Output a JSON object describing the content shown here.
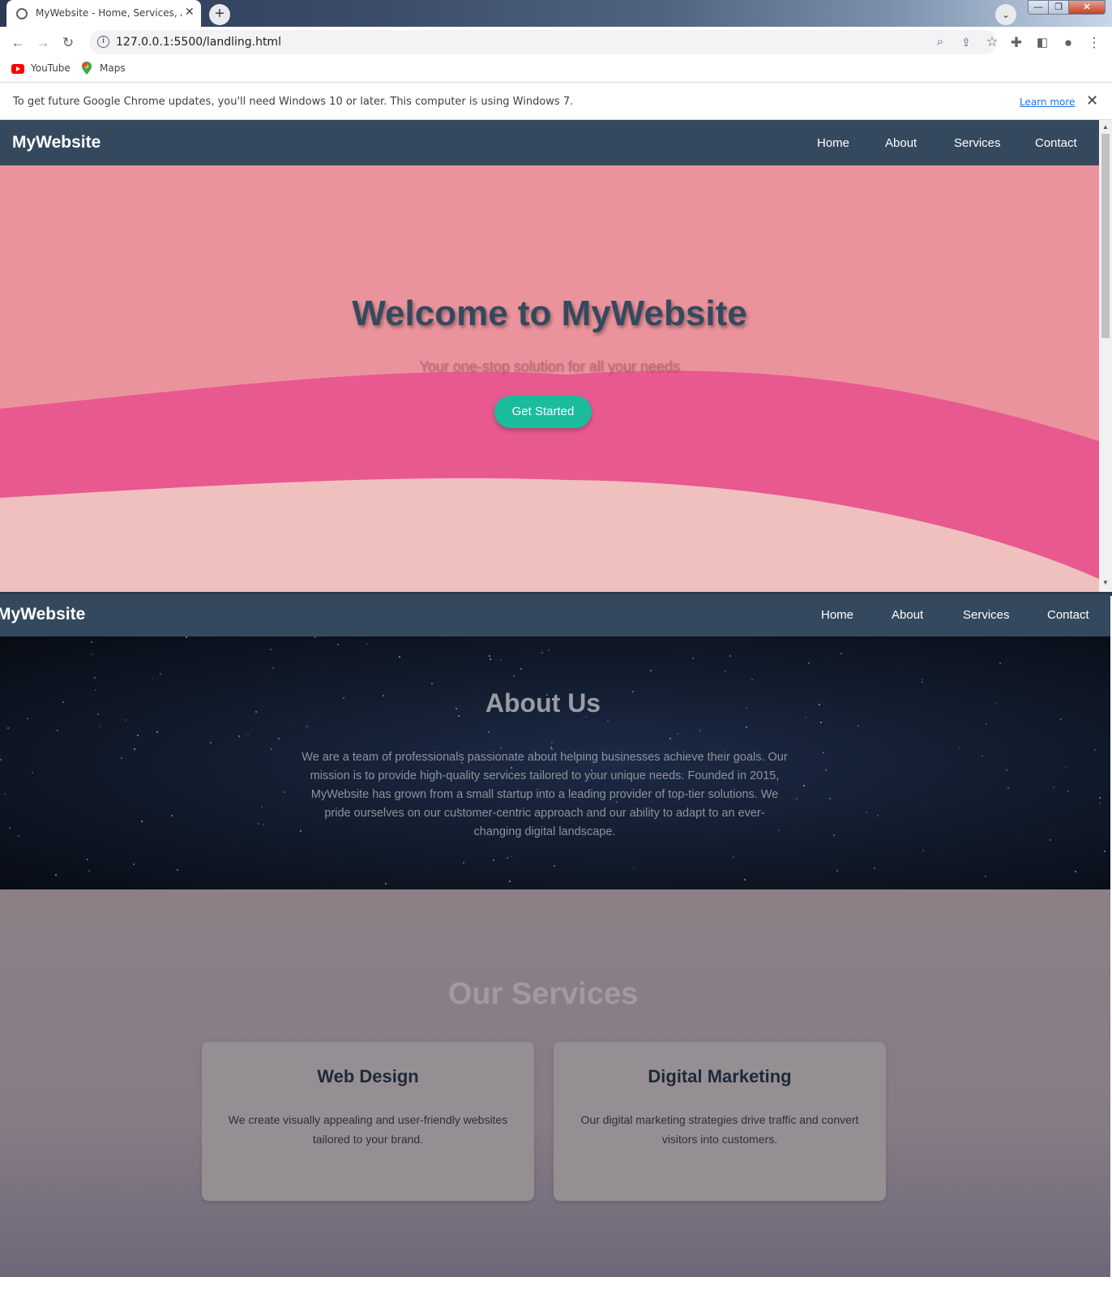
{
  "browser": {
    "tab_title": "MyWebsite - Home, Services, Ab",
    "url": "127.0.0.1:5500/landling.html",
    "bookmarks": [
      {
        "label": "YouTube",
        "icon": "youtube-icon"
      },
      {
        "label": "Maps",
        "icon": "maps-icon"
      }
    ],
    "infobar_text": "To get future Google Chrome updates, you'll need Windows 10 or later. This computer is using Windows 7.",
    "infobar_link": "Learn more"
  },
  "site": {
    "brand": "MyWebsite",
    "nav": [
      "Home",
      "About",
      "Services",
      "Contact"
    ],
    "colors": {
      "navbar": "#34495e",
      "accent": "#1abc9c",
      "hero_bg": "#eb939c"
    }
  },
  "hero": {
    "title": "Welcome to MyWebsite",
    "subtitle": "Your one-stop solution for all your needs",
    "cta": "Get Started"
  },
  "about": {
    "title": "About Us",
    "text": "We are a team of professionals passionate about helping businesses achieve their goals. Our mission is to provide high-quality services tailored to your unique needs. Founded in 2015, MyWebsite has grown from a small startup into a leading provider of top-tier solutions. We pride ourselves on our customer-centric approach and our ability to adapt to an ever-changing digital landscape."
  },
  "services": {
    "title": "Our Services",
    "cards": [
      {
        "title": "Web Design",
        "text": "We create visually appealing and user-friendly websites tailored to your brand."
      },
      {
        "title": "Digital Marketing",
        "text": "Our digital marketing strategies drive traffic and convert visitors into customers."
      }
    ]
  }
}
